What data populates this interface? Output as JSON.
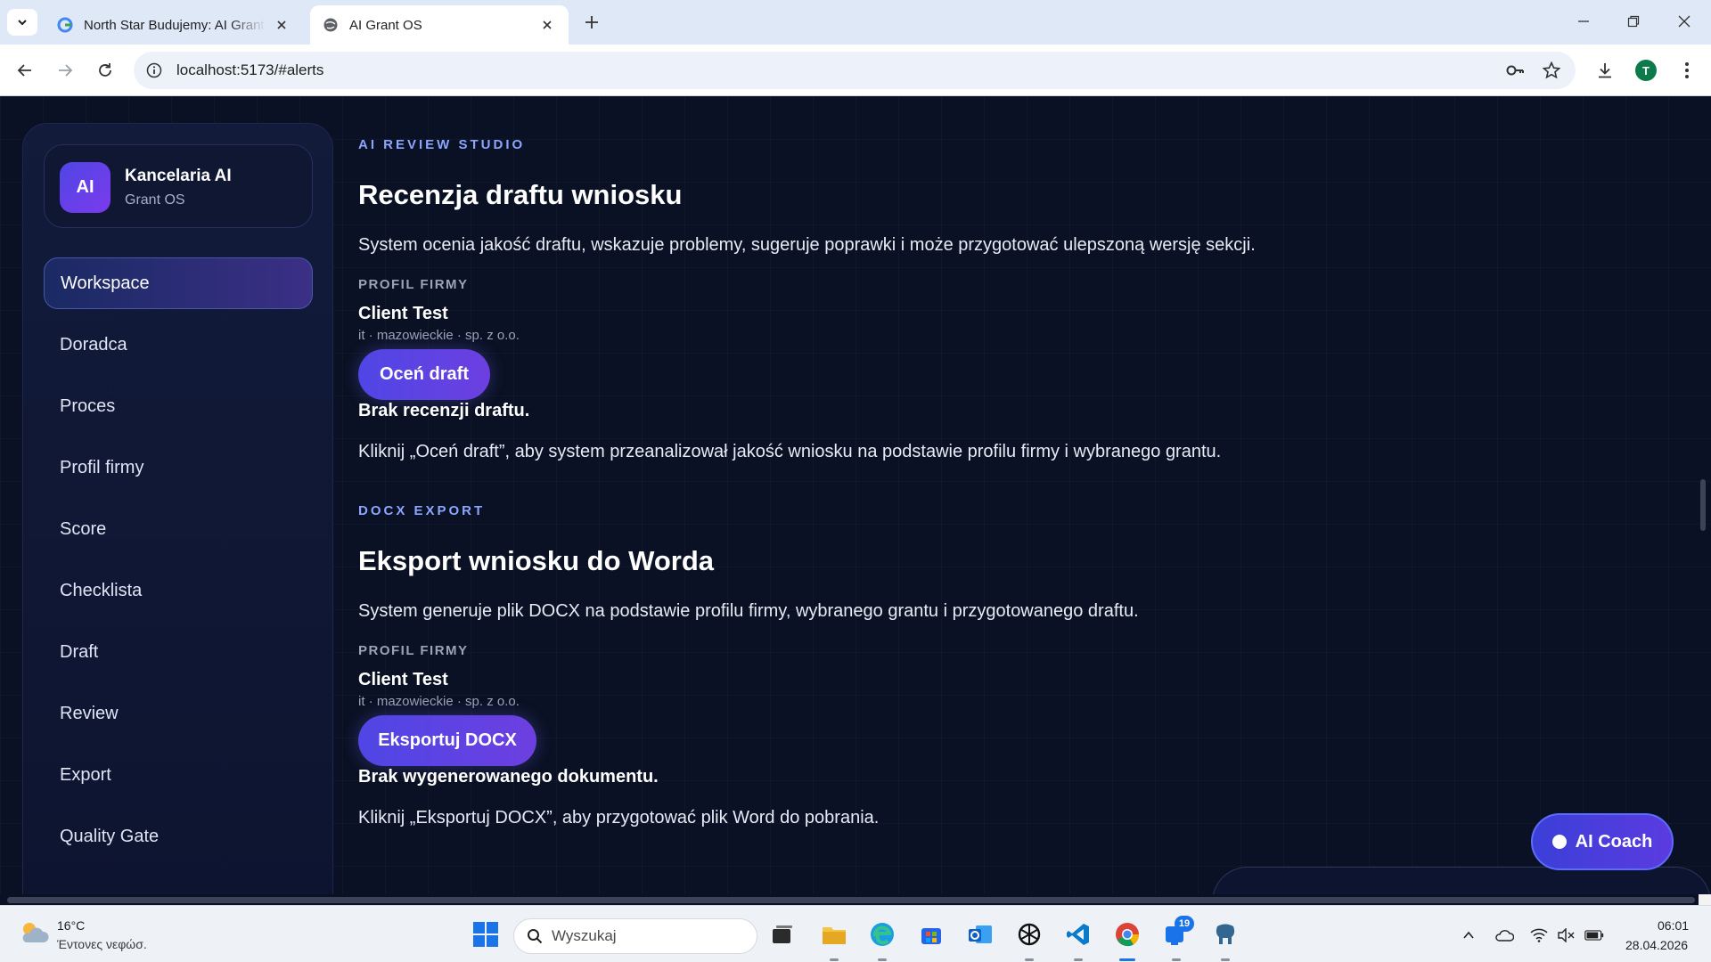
{
  "browser": {
    "tabs": [
      {
        "title": "North Star Budujemy: AI Grant OS",
        "active": false
      },
      {
        "title": "AI Grant OS",
        "active": true
      }
    ],
    "url": "localhost:5173/#alerts",
    "profile_initial": "T"
  },
  "sidebar": {
    "brand_logo": "AI",
    "brand_name": "Kancelaria AI",
    "brand_sub": "Grant OS",
    "items": [
      {
        "label": "Workspace",
        "active": true
      },
      {
        "label": "Doradca"
      },
      {
        "label": "Proces"
      },
      {
        "label": "Profil firmy"
      },
      {
        "label": "Score"
      },
      {
        "label": "Checklista"
      },
      {
        "label": "Draft"
      },
      {
        "label": "Review"
      },
      {
        "label": "Export"
      },
      {
        "label": "Quality Gate"
      }
    ]
  },
  "review": {
    "eyebrow": "AI REVIEW STUDIO",
    "title": "Recenzja draftu wniosku",
    "description": "System ocenia jakość draftu, wskazuje problemy, sugeruje poprawki i może przygotować ulepszoną wersję sekcji.",
    "profile_label": "PROFIL FIRMY",
    "client_name": "Client Test",
    "client_meta": "it · mazowieckie · sp. z o.o.",
    "button_label": "Oceń draft",
    "empty_title": "Brak recenzji draftu.",
    "empty_hint": "Kliknij „Oceń draft”, aby system przeanalizował jakość wniosku na podstawie profilu firmy i wybranego grantu."
  },
  "export": {
    "eyebrow": "DOCX EXPORT",
    "title": "Eksport wniosku do Worda",
    "description": "System generuje plik DOCX na podstawie profilu firmy, wybranego grantu i przygotowanego draftu.",
    "profile_label": "PROFIL FIRMY",
    "client_name": "Client Test",
    "client_meta": "it · mazowieckie · sp. z o.o.",
    "button_label": "Eksportuj DOCX",
    "empty_title": "Brak wygenerowanego dokumentu.",
    "empty_hint": "Kliknij „Eksportuj DOCX”, aby przygotować plik Word do pobrania."
  },
  "coach": {
    "label": "AI Coach"
  },
  "taskbar": {
    "weather_temp": "16°C",
    "weather_desc": "Έντονες νεφώσ.",
    "search_placeholder": "Wyszukaj",
    "notification_count": "19",
    "time": "06:01",
    "date": "28.04.2026"
  },
  "colors": {
    "page_bg": "#0b1124",
    "accent": "#4f46e5",
    "eyebrow": "#8aa6ff",
    "sidebar_active": "#3b2f86"
  },
  "icons": [
    "tab-menu-icon",
    "google-icon",
    "globe-icon",
    "close-icon",
    "plus-icon",
    "minimize-icon",
    "restore-icon",
    "window-close-icon",
    "back-icon",
    "forward-icon",
    "reload-icon",
    "info-icon",
    "key-icon",
    "star-icon",
    "download-icon",
    "kebab-menu-icon",
    "weather-icon",
    "windows-start-icon",
    "search-icon",
    "task-view-icon",
    "file-explorer-icon",
    "edge-icon",
    "store-icon",
    "outlook-icon",
    "chatgpt-icon",
    "vscode-icon",
    "chrome-icon",
    "teams-icon",
    "postgres-icon",
    "chevron-up-icon",
    "cloud-icon",
    "wifi-icon",
    "speaker-muted-icon",
    "battery-icon"
  ]
}
